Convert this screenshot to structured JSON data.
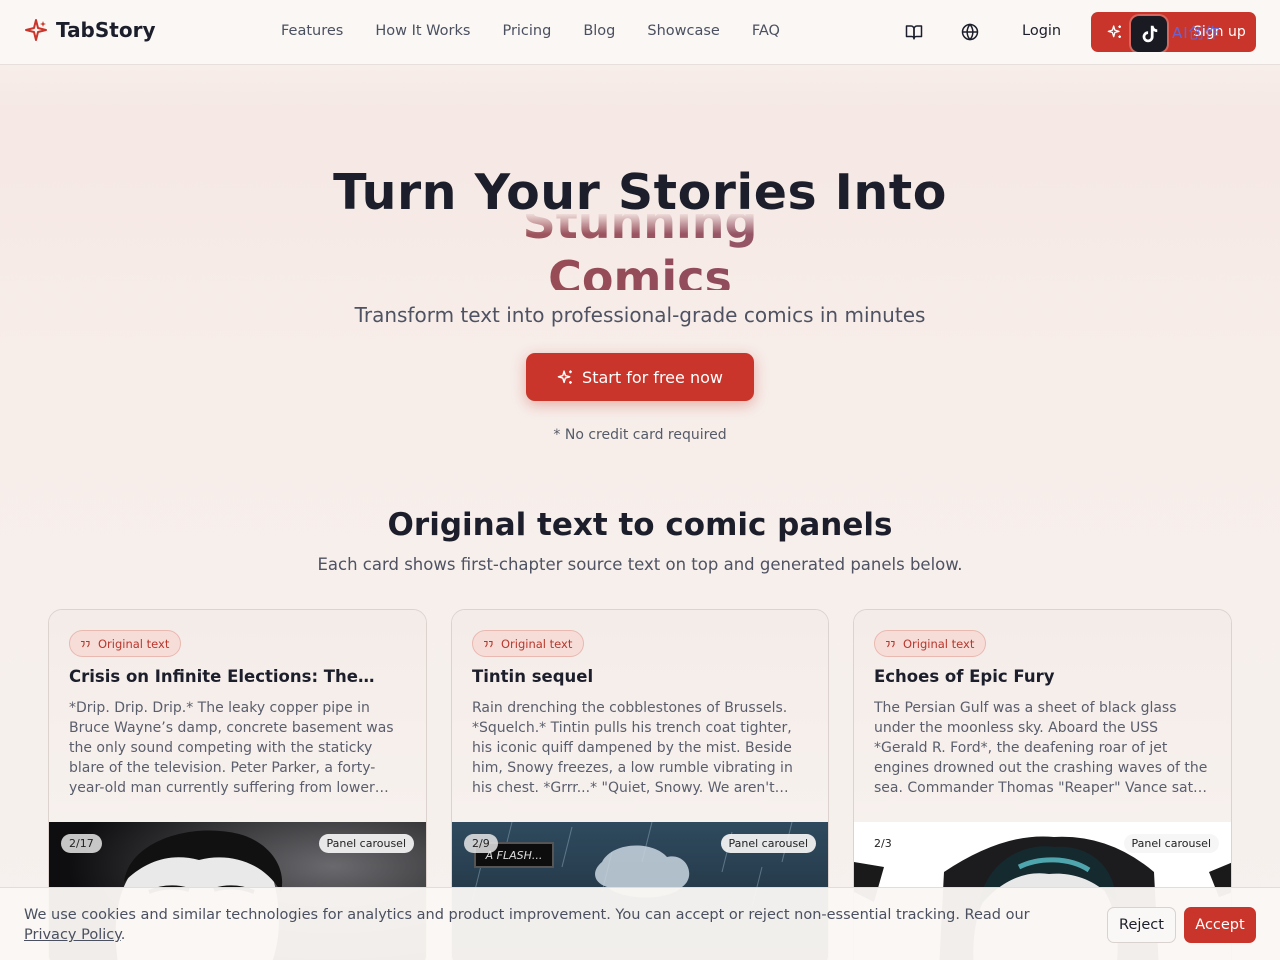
{
  "header": {
    "logo_text": "TabStory",
    "nav": [
      "Features",
      "How It Works",
      "Pricing",
      "Blog",
      "Showcase",
      "FAQ"
    ],
    "icons": [
      "book-icon",
      "globe-icon"
    ],
    "login_label": "Login",
    "cta_label": "Sign up",
    "overlay_text": "AI创作"
  },
  "hero": {
    "title": "Turn Your Stories Into",
    "rolling_words": [
      "Stunning",
      "Comics"
    ],
    "subtitle": "Transform text into professional-grade comics in minutes",
    "cta_label": "Start for free now",
    "note": "* No credit card required"
  },
  "section": {
    "title": "Original text to comic panels",
    "subtitle": "Each card shows first-chapter source text on top and generated panels below."
  },
  "cards": [
    {
      "badge": "Original text",
      "title": "Crisis on Infinite Elections: The…",
      "text": "*Drip. Drip. Drip.* The leaky copper pipe in Bruce Wayne’s damp, concrete basement was the only sound competing with the staticky blare of the television. Peter Parker, a forty-year-old man currently suffering from lower…",
      "count": "2/17",
      "carousel": "Panel carousel"
    },
    {
      "badge": "Original text",
      "title": "Tintin sequel",
      "text": "Rain drenching the cobblestones of Brussels. *Squelch.* Tintin pulls his trench coat tighter, his iconic quiff dampened by the mist. Beside him, Snowy freezes, a low rumble vibrating in his chest. *Grrr...* \"Quiet, Snowy. We aren't…",
      "count": "2/9",
      "carousel": "Panel carousel",
      "panel_caption": "A FLASH..."
    },
    {
      "badge": "Original text",
      "title": "Echoes of Epic Fury",
      "text": "The Persian Gulf was a sheet of black glass under the moonless sky. Aboard the USS *Gerald R. Ford*, the deafening roar of jet engines drowned out the crashing waves of the sea. Commander Thomas \"Reaper\" Vance sat…",
      "count": "2/3",
      "carousel": "Panel carousel"
    }
  ],
  "cookie": {
    "text": "We use cookies and similar technologies for analytics and product improvement. You can accept or reject non-essential tracking. Read our ",
    "link": "Privacy Policy",
    "end": ".",
    "reject": "Reject",
    "accept": "Accept"
  },
  "colors": {
    "accent": "#c9352a",
    "text": "#1c1f2b",
    "muted": "#4e5262"
  }
}
